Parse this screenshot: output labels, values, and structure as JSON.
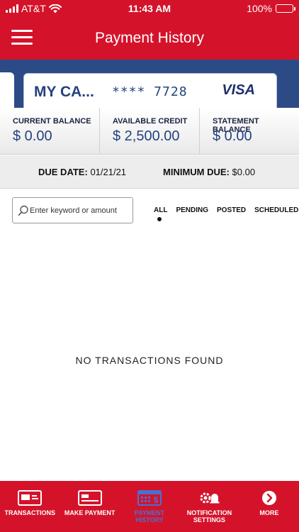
{
  "status_bar": {
    "carrier": "AT&T",
    "time": "11:43 AM",
    "battery": "100%"
  },
  "header": {
    "title": "Payment History",
    "menu_icon": "hamburger-menu-icon"
  },
  "card": {
    "name": "MY CA...",
    "number": "**** 7728",
    "brand": "VISA"
  },
  "balances": [
    {
      "label": "CURRENT BALANCE",
      "value": "$ 0.00"
    },
    {
      "label": "AVAILABLE CREDIT",
      "value": "$ 2,500.00"
    },
    {
      "label": "STATEMENT BALANCE",
      "value": "$ 0.00"
    }
  ],
  "due": {
    "date_label": "DUE DATE:",
    "date_value": "01/21/21",
    "min_label": "MINIMUM DUE:",
    "min_value": "$0.00"
  },
  "search": {
    "placeholder": "Enter keyword or amount",
    "value": ""
  },
  "filters": {
    "items": [
      "ALL",
      "PENDING",
      "POSTED",
      "SCHEDULED"
    ],
    "selected": "ALL"
  },
  "empty_message": "NO TRANSACTIONS FOUND",
  "bottom_nav": [
    {
      "label": "TRANSACTIONS",
      "icon": "transactions-card-icon",
      "active": false
    },
    {
      "label": "MAKE PAYMENT",
      "icon": "payment-card-icon",
      "active": false
    },
    {
      "label": "PAYMENT HISTORY",
      "icon": "calendar-dollar-icon",
      "active": true
    },
    {
      "label": "NOTIFICATION SETTINGS",
      "icon": "gear-bell-icon",
      "active": false
    },
    {
      "label": "MORE",
      "icon": "chevron-right-circle-icon",
      "active": false
    }
  ],
  "colors": {
    "brand_red": "#d4132b",
    "card_band_blue": "#2c4a86",
    "value_blue": "#24427c",
    "active_nav_blue": "#4b6fd1"
  }
}
